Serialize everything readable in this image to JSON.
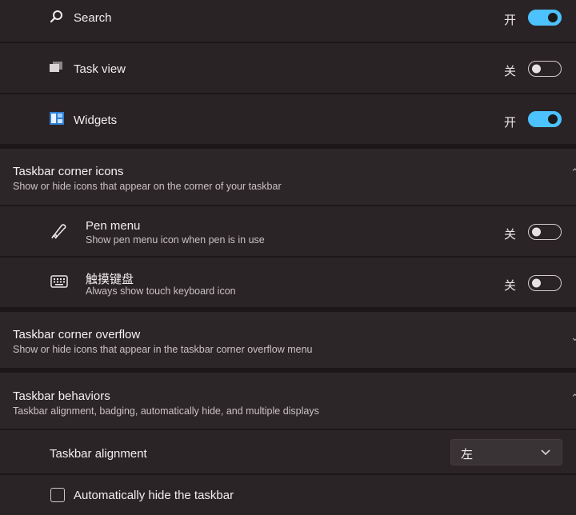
{
  "items": {
    "search": {
      "label": "Search",
      "state": "开"
    },
    "task_view": {
      "label": "Task view",
      "state": "关"
    },
    "widgets": {
      "label": "Widgets",
      "state": "开"
    }
  },
  "corner_icons": {
    "title": "Taskbar corner icons",
    "desc": "Show or hide icons that appear on the corner of your taskbar",
    "pen_menu": {
      "label": "Pen menu",
      "desc": "Show pen menu icon when pen is in use",
      "state": "关"
    },
    "touch_keyboard": {
      "label": "触摸键盘",
      "desc": "Always show touch keyboard icon",
      "state": "关"
    }
  },
  "corner_overflow": {
    "title": "Taskbar corner overflow",
    "desc": "Show or hide icons that appear in the taskbar corner overflow menu"
  },
  "behaviors": {
    "title": "Taskbar behaviors",
    "desc": "Taskbar alignment, badging, automatically hide, and multiple displays",
    "alignment_label": "Taskbar alignment",
    "alignment_value": "左",
    "autohide_label": "Automatically hide the taskbar"
  },
  "colors": {
    "accent": "#4cc2ff",
    "background": "#1c1718",
    "card": "#2a2326"
  }
}
